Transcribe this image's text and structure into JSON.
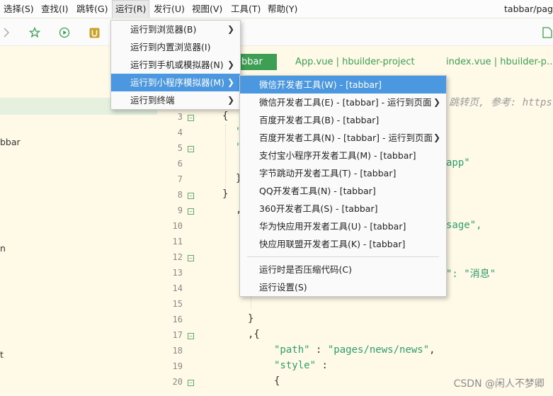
{
  "menubar": {
    "items": [
      "选择(S)",
      "查找(I)",
      "跳转(G)",
      "运行(R)",
      "发行(U)",
      "视图(V)",
      "工具(T)",
      "帮助(Y)"
    ],
    "window_title": "tabbar/pag"
  },
  "toolbar": {
    "icons": [
      "chevron-right-icon",
      "star-icon",
      "play-circle-icon",
      "uni-app-icon",
      "file-icon"
    ]
  },
  "leftpanel": {
    "texts": [
      "bbar",
      "n",
      "t"
    ]
  },
  "tabs": {
    "active": "bbar",
    "items": [
      "App.vue | hbuilder-project",
      "index.vue | hbuilder-p......"
    ]
  },
  "editor": {
    "comment": "跳转页, 参考: https:",
    "line_numbers": [
      "3",
      "4",
      "5",
      "6",
      "7",
      "8",
      "9",
      "10",
      "11",
      "12",
      "13",
      "14",
      "15",
      "16",
      "17",
      "18",
      "19",
      "20"
    ],
    "code_fragments": {
      "l3": "{",
      "l4": "\"",
      "l5": "\"",
      "l6": "app\"",
      "l7": "}",
      "l8": "}",
      "l9": ",",
      "l10": "sage\",",
      "l13_str": "\": \"消息\"",
      "l16": "}",
      "l17": ",{",
      "l18_key": "\"path\"",
      "l18_sep": " : ",
      "l18_val": "\"pages/news/news\"",
      "l18_end": ",",
      "l19_key": "\"style\"",
      "l19_sep": " :",
      "l20": "{"
    }
  },
  "run_menu": {
    "items": [
      {
        "label": "运行到浏览器(B)",
        "submenu": true
      },
      {
        "label": "运行到内置浏览器(I)",
        "submenu": false
      },
      {
        "label": "运行到手机或模拟器(N)",
        "submenu": true
      },
      {
        "label": "运行到小程序模拟器(M)",
        "submenu": true,
        "selected": true
      },
      {
        "label": "运行到终端",
        "submenu": true
      }
    ]
  },
  "mp_menu": {
    "items": [
      {
        "label": "微信开发者工具(W) - [tabbar]",
        "submenu": false,
        "selected": true
      },
      {
        "label": "微信开发者工具(E) - [tabbar] - 运行到页面",
        "submenu": true
      },
      {
        "label": "百度开发者工具(B) - [tabbar]",
        "submenu": false
      },
      {
        "label": "百度开发者工具(N) - [tabbar] - 运行到页面",
        "submenu": true
      },
      {
        "label": "支付宝小程序开发者工具(M) - [tabbar]",
        "submenu": false
      },
      {
        "label": "字节跳动开发者工具(T) - [tabbar]",
        "submenu": false
      },
      {
        "label": "QQ开发者工具(N) - [tabbar]",
        "submenu": false
      },
      {
        "label": "360开发者工具(S) - [tabbar]",
        "submenu": false
      },
      {
        "label": "华为快应用开发者工具(U) - [tabbar]",
        "submenu": false
      },
      {
        "label": "快应用联盟开发者工具(K) - [tabbar]",
        "submenu": false
      }
    ],
    "extra": [
      {
        "label": "运行时是否压缩代码(C)"
      },
      {
        "label": "运行设置(S)"
      }
    ]
  },
  "watermark": "CSDN @闲人不梦卿",
  "colors": {
    "accent_green": "#3d9f54",
    "selection_blue": "#4b97e0",
    "editor_bg": "#fffae8"
  }
}
